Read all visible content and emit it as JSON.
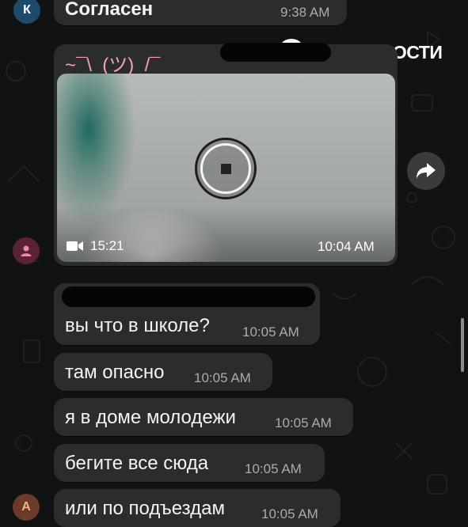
{
  "watermark": {
    "text": "РИА НОВОСТИ"
  },
  "top_message": {
    "avatar_letter": "К",
    "text": "Согласен",
    "time": "9:38 AM"
  },
  "video_message": {
    "caption": "~¯\\_(ツ)_/¯",
    "duration": "15:21",
    "time": "10:04 AM"
  },
  "messages": [
    {
      "text": "вы что в школе?",
      "time": "10:05 AM"
    },
    {
      "text": "там опасно",
      "time": "10:05 AM"
    },
    {
      "text": "я в доме молодежи",
      "time": "10:05 AM"
    },
    {
      "text": "бегите все сюда",
      "time": "10:05 AM"
    },
    {
      "text": "или по подъездам",
      "time": "10:05 AM"
    }
  ],
  "bottom_avatar": {
    "letter": "А"
  },
  "icons": [
    "person-icon",
    "video-camera-icon",
    "stop-icon",
    "forward-icon",
    "ria-logo-icon"
  ],
  "colors": {
    "bubble": "#2b2c2e",
    "background": "#111213",
    "pink_caption": "#f3a0b8",
    "avatar_blue": "#1e4a6b"
  }
}
